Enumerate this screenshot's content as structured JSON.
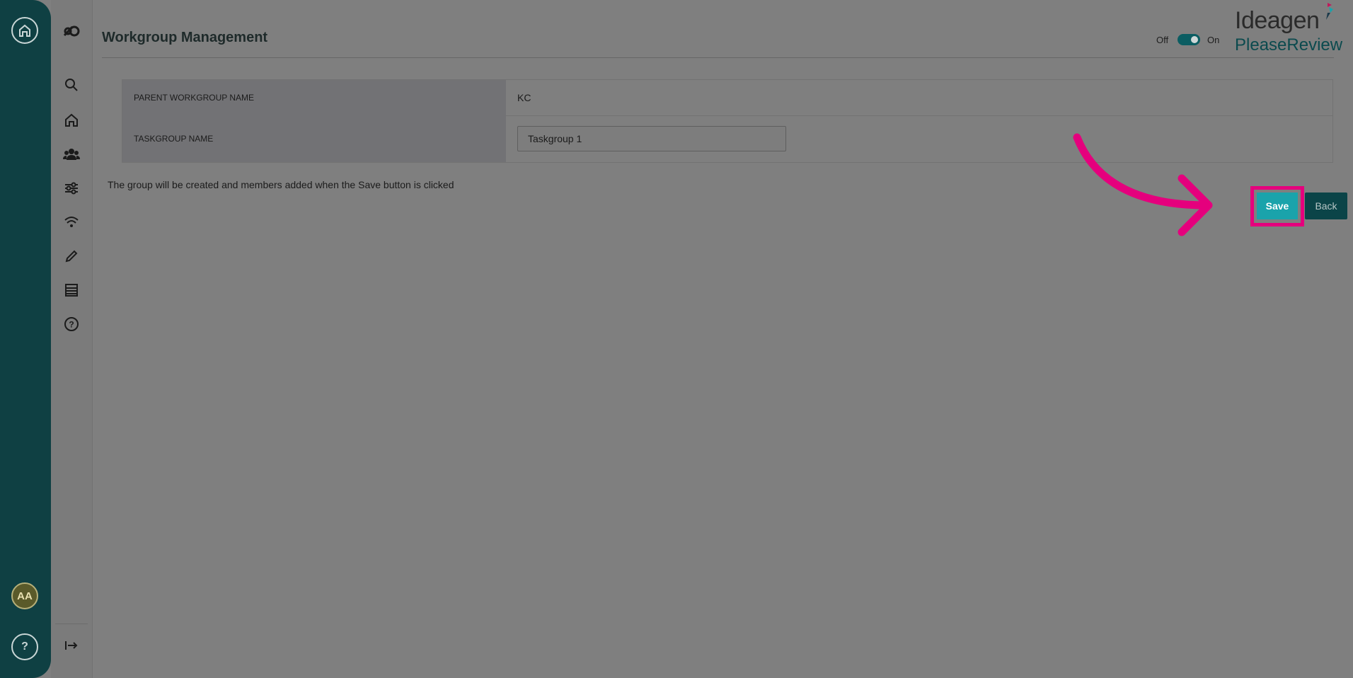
{
  "rail": {
    "home_icon": "home-icon",
    "avatar_initials": "AA",
    "help_label": "?"
  },
  "nav": {
    "items": [
      "logo-icon",
      "search-icon",
      "home-icon",
      "users-icon",
      "sliders-icon",
      "signal-icon",
      "pencil-icon",
      "list-icon",
      "help-circle-icon"
    ],
    "expand_icon": "expand-icon"
  },
  "header": {
    "title": "Workgroup Management",
    "toggle_off_label": "Off",
    "toggle_on_label": "On",
    "toggle_state": "on",
    "logo_line1": "Ideagen",
    "logo_line2": "PleaseReview"
  },
  "form": {
    "parent_label": "PARENT WORKGROUP NAME",
    "parent_value": "KC",
    "taskgroup_label": "TASKGROUP NAME",
    "taskgroup_value": "Taskgroup 1"
  },
  "info_text": "The group will be created and members added when the Save button is clicked",
  "actions": {
    "save_label": "Save",
    "back_label": "Back"
  },
  "colors": {
    "rail": "#0f4043",
    "save": "#1aa3ab",
    "back": "#0b4448",
    "highlight": "#e5007d"
  }
}
